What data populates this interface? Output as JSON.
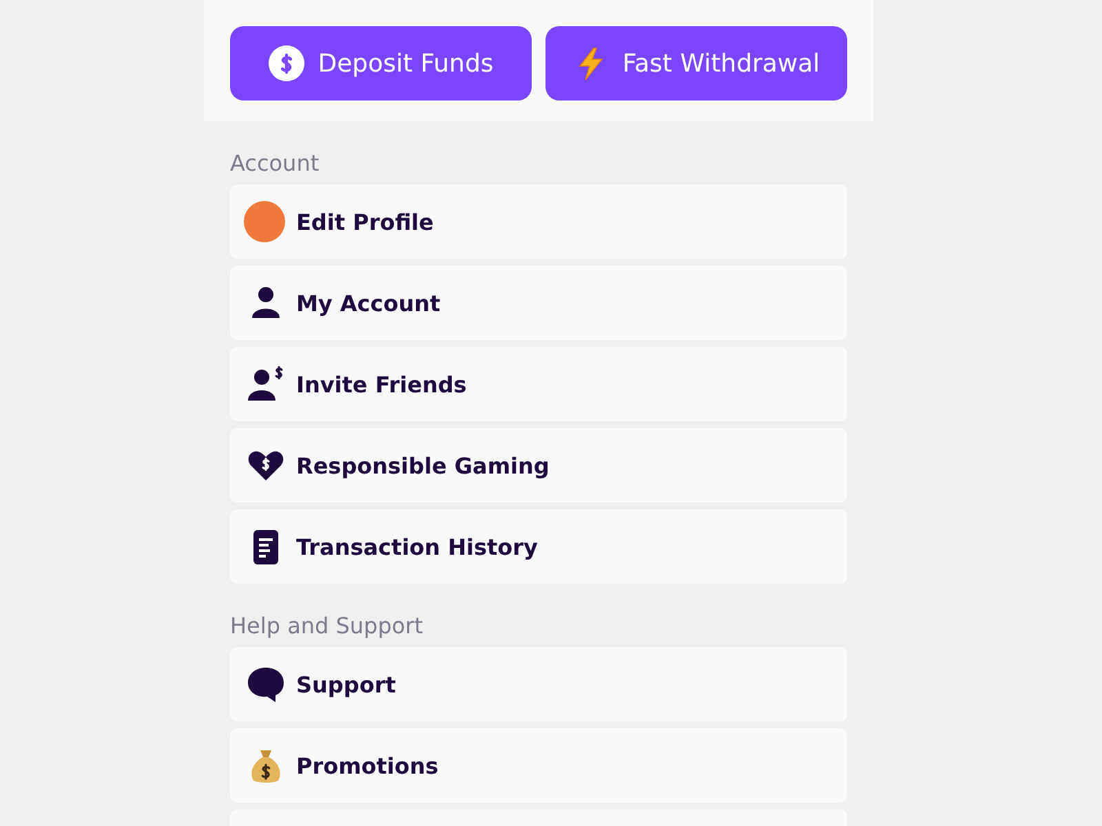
{
  "actions": [
    {
      "kind": "deposit",
      "label": "Deposit Funds"
    },
    {
      "kind": "withdraw",
      "label": "Fast Withdrawal"
    }
  ],
  "sections": [
    {
      "title": "Account",
      "items": [
        {
          "kind": "avatar",
          "label": "Edit Profile"
        },
        {
          "kind": "person",
          "label": "My Account"
        },
        {
          "kind": "invite",
          "label": "Invite Friends"
        },
        {
          "kind": "heart",
          "label": "Responsible Gaming"
        },
        {
          "kind": "document",
          "label": "Transaction History"
        }
      ]
    },
    {
      "title": "Help and Support",
      "items": [
        {
          "kind": "chat",
          "label": "Support"
        },
        {
          "kind": "moneybag",
          "label": "Promotions"
        }
      ]
    }
  ]
}
